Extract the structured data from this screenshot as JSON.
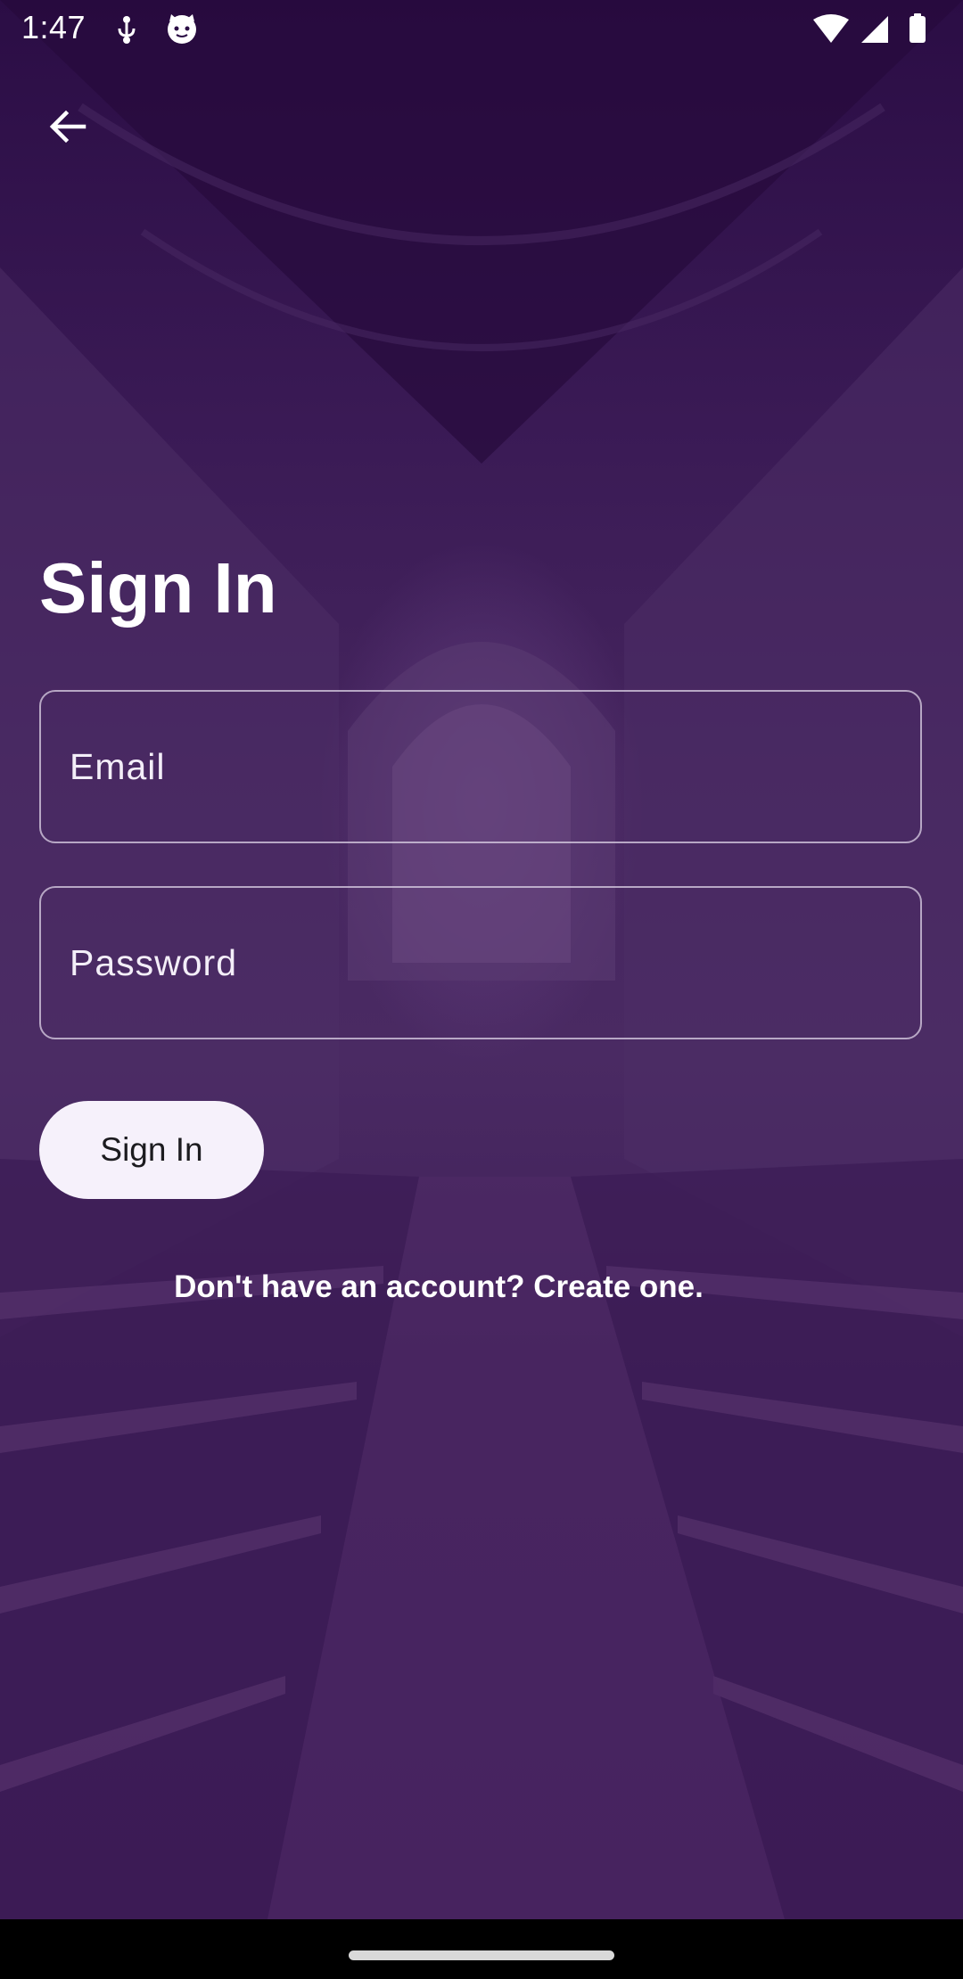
{
  "status_bar": {
    "time": "1:47",
    "left_icons": [
      "usb-debug-icon",
      "cat-face-icon"
    ],
    "right_icons": [
      "wifi-icon",
      "signal-icon",
      "battery-icon"
    ]
  },
  "header": {
    "back_icon": "arrow-left-icon"
  },
  "form": {
    "title": "Sign In",
    "email_placeholder": "Email",
    "password_placeholder": "Password",
    "submit_label": "Sign In",
    "create_account_text": "Don't have an account? Create one."
  },
  "colors": {
    "overlay": "#3a1a55",
    "text": "#ffffff",
    "button_bg": "#f6f1fb",
    "button_text": "#1c1b1f",
    "field_border": "#dcd2e6",
    "nav_bar": "#000000"
  }
}
